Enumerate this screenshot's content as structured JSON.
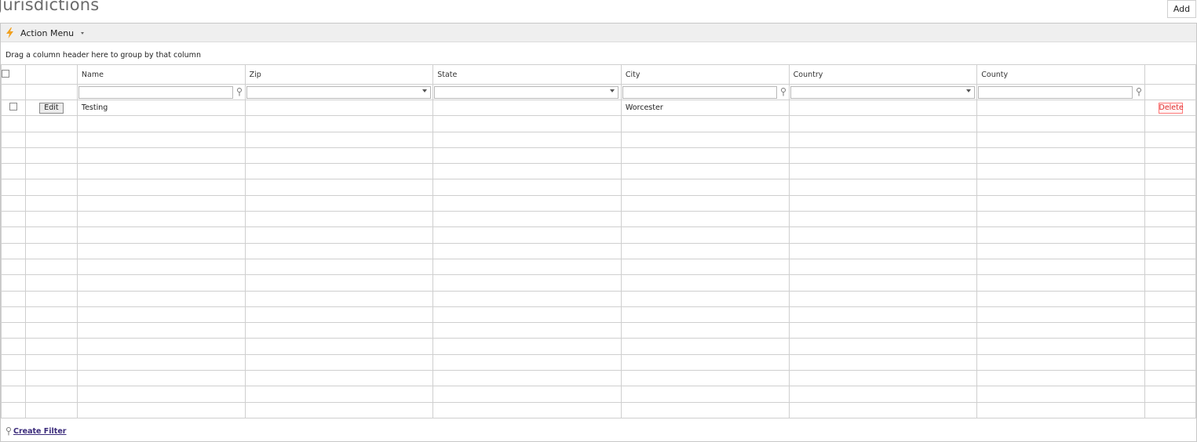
{
  "page": {
    "title": "Jurisdictions",
    "add_label": "Add"
  },
  "toolbar": {
    "action_menu_label": "Action Menu"
  },
  "grid": {
    "group_hint": "Drag a column header here to group by that column",
    "columns": [
      {
        "label": "Name",
        "filter": "text"
      },
      {
        "label": "Zip",
        "filter": "dropdown"
      },
      {
        "label": "State",
        "filter": "dropdown"
      },
      {
        "label": "City",
        "filter": "text"
      },
      {
        "label": "Country",
        "filter": "dropdown"
      },
      {
        "label": "County",
        "filter": "text"
      }
    ],
    "rows": [
      {
        "edit_label": "Edit",
        "name": "Testing",
        "zip": "",
        "state": "",
        "city": "Worcester",
        "country": "",
        "county": "",
        "delete_label": "Delete"
      }
    ],
    "empty_rows": 19
  },
  "footer": {
    "create_filter_label": "Create Filter"
  },
  "colors": {
    "accent": "#f0a020",
    "delete": "#e03030",
    "link": "#3a2a7a"
  }
}
